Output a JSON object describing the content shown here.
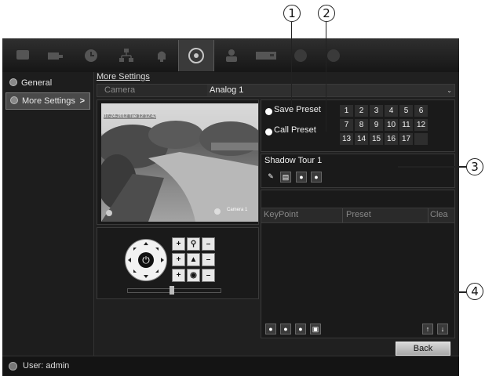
{
  "callouts": [
    "1",
    "2",
    "3",
    "4"
  ],
  "topbar": {
    "icons": [
      "monitor-icon",
      "camera-icon",
      "clock-icon",
      "network-icon",
      "alarm-icon",
      "ptz-icon",
      "user-icon",
      "hdd-icon",
      "record-icon",
      "power-icon"
    ],
    "active_index": 5
  },
  "sidebar": {
    "items": [
      {
        "label": "General",
        "icon": "gear-icon",
        "selected": false
      },
      {
        "label": "More Settings",
        "icon": "gear-icon",
        "selected": true,
        "arrow": ">"
      }
    ]
  },
  "main": {
    "breadcrumb": "More Settings",
    "camera_label": "Camera",
    "camera_value": "Analog 1",
    "preview": {
      "timestamp": "07-24-2012 Tue 12:12:42 ",
      "camera_overlay": "Camera 1"
    },
    "preset": {
      "save_label": "Save Preset",
      "call_label": "Call Preset",
      "numbers": [
        "1",
        "2",
        "3",
        "4",
        "5",
        "6",
        "7",
        "8",
        "9",
        "10",
        "11",
        "12",
        "13",
        "14",
        "15",
        "16",
        "17",
        ""
      ]
    },
    "tour": {
      "name": "Shadow Tour 1",
      "columns": [
        "KeyPoint",
        "Preset",
        "Clea"
      ]
    },
    "back_label": "Back"
  },
  "footer": {
    "user": "User: admin"
  },
  "colors": {
    "background": "#1b1b1b",
    "panel": "#1a1a1a",
    "selected": "#4a4a4a"
  }
}
